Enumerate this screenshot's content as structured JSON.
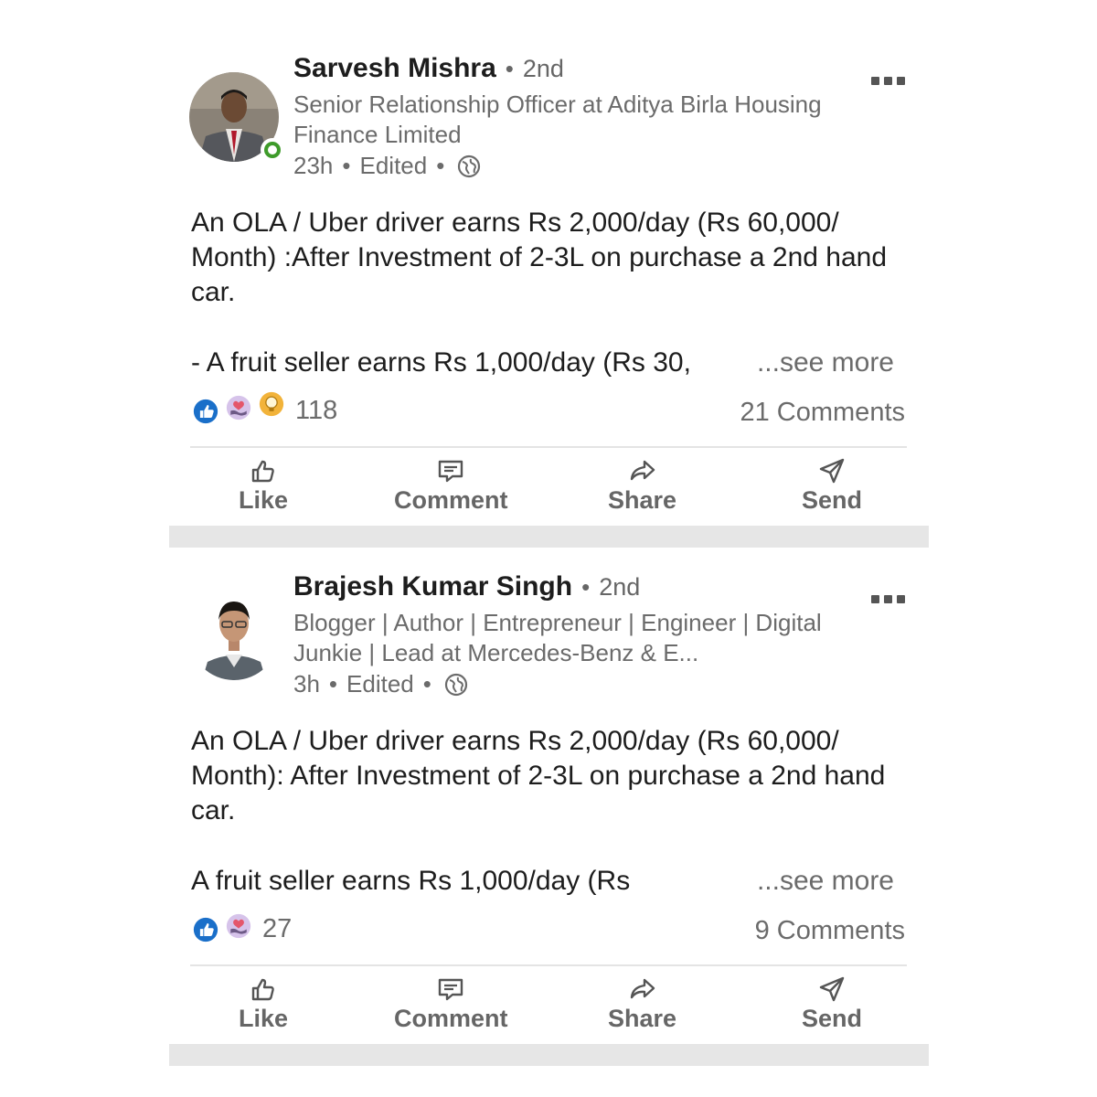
{
  "posts": [
    {
      "author": "Sarvesh Mishra",
      "degree": "2nd",
      "headline": "Senior Relationship Officer at Aditya Birla Housing Finance Limited",
      "time": "23h",
      "edited": "Edited",
      "body": "An OLA / Uber driver earns Rs 2,000/day (Rs 60,000/ Month) :After Investment of 2-3L on purchase a 2nd hand car.",
      "teaser": "- A fruit seller earns Rs 1,000/day (Rs 30,",
      "see_more": "...see more",
      "reaction_count": "118",
      "comments": "21 Comments",
      "reactions": [
        "like-icon",
        "support-icon",
        "insightful-icon"
      ],
      "online": true
    },
    {
      "author": "Brajesh Kumar Singh",
      "degree": "2nd",
      "headline": "Blogger | Author | Entrepreneur | Engineer | Digital Junkie | Lead at Mercedes-Benz & E...",
      "time": "3h",
      "edited": "Edited",
      "body": "An OLA / Uber driver earns Rs 2,000/day (Rs 60,000/ Month): After Investment of 2-3L on purchase a 2nd hand car.",
      "teaser": "A fruit seller earns Rs 1,000/day (Rs",
      "see_more": "...see more",
      "reaction_count": "27",
      "comments": "9 Comments",
      "reactions": [
        "like-icon",
        "support-icon"
      ],
      "online": false
    }
  ],
  "actions": {
    "like": "Like",
    "comment": "Comment",
    "share": "Share",
    "send": "Send"
  },
  "colors": {
    "like_blue": "#1a6fc9",
    "support_purple": "#c9a6e0",
    "insightful_yellow": "#f2b33a",
    "online_green": "#3e9b2a"
  }
}
